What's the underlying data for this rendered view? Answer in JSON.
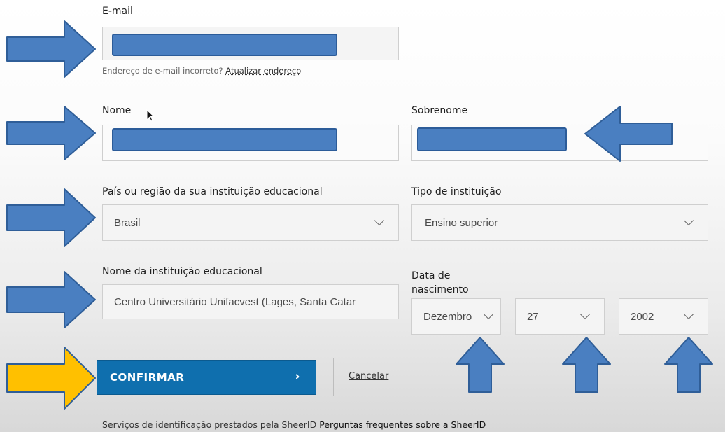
{
  "form": {
    "email": {
      "label": "E-mail",
      "value": ""
    },
    "email_note": {
      "text": "Endereço de e-mail incorreto? ",
      "link": "Atualizar endereço"
    },
    "first_name": {
      "label": "Nome",
      "value": ""
    },
    "last_name": {
      "label": "Sobrenome",
      "value": ""
    },
    "country": {
      "label": "País ou região da sua instituição educacional",
      "value": "Brasil"
    },
    "institution_type": {
      "label": "Tipo de instituição",
      "value": "Ensino superior"
    },
    "institution_name": {
      "label": "Nome da instituição educacional",
      "value": "Centro Universitário Unifacvest (Lages, Santa Catar"
    },
    "birth_date": {
      "label_line1": "Data de",
      "label_line2": "nascimento",
      "month": "Dezembro",
      "day": "27",
      "year": "2002"
    }
  },
  "actions": {
    "confirm_label": "CONFIRMAR",
    "confirm_chevron": "›",
    "cancel_label": "Cancelar"
  },
  "footer": {
    "text": "Serviços de identificação prestados pela SheerID ",
    "link": "Perguntas frequentes sobre a SheerID"
  },
  "colors": {
    "arrow_blue": "#4a7fc1",
    "arrow_yellow": "#ffc000",
    "button_blue": "#0f6fae"
  },
  "icons": [
    "chevron-down-icon",
    "mouse-cursor-icon",
    "arrow-right-icon",
    "arrow-left-icon",
    "arrow-up-icon"
  ]
}
